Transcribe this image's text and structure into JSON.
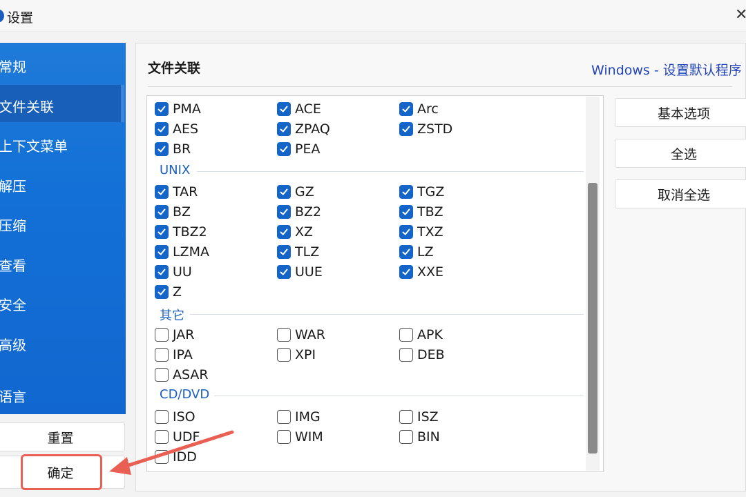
{
  "window": {
    "title": "设置"
  },
  "sidebar": {
    "items": [
      {
        "label": "常规",
        "active": false
      },
      {
        "label": "文件关联",
        "active": true
      },
      {
        "label": "上下文菜单",
        "active": false
      },
      {
        "label": "解压",
        "active": false
      },
      {
        "label": "压缩",
        "active": false
      },
      {
        "label": "查看",
        "active": false
      },
      {
        "label": "安全",
        "active": false
      },
      {
        "label": "高级",
        "active": false
      },
      {
        "label": "语言",
        "active": false
      }
    ],
    "reset_label": "重置",
    "ok_label": "确定"
  },
  "panel": {
    "title": "文件关联",
    "windows_link": "Windows - 设置默认程序"
  },
  "groups": {
    "unix": "UNIX",
    "other": "其它",
    "cd": "CD/DVD"
  },
  "formats": [
    {
      "label": "PMA",
      "checked": true
    },
    {
      "label": "ACE",
      "checked": true
    },
    {
      "label": "Arc",
      "checked": true
    },
    {
      "label": "AES",
      "checked": true
    },
    {
      "label": "ZPAQ",
      "checked": true
    },
    {
      "label": "ZSTD",
      "checked": true
    },
    {
      "label": "BR",
      "checked": true
    },
    {
      "label": "PEA",
      "checked": true
    },
    {
      "label": "TAR",
      "checked": true
    },
    {
      "label": "GZ",
      "checked": true
    },
    {
      "label": "TGZ",
      "checked": true
    },
    {
      "label": "BZ",
      "checked": true
    },
    {
      "label": "BZ2",
      "checked": true
    },
    {
      "label": "TBZ",
      "checked": true
    },
    {
      "label": "TBZ2",
      "checked": true
    },
    {
      "label": "XZ",
      "checked": true
    },
    {
      "label": "TXZ",
      "checked": true
    },
    {
      "label": "LZMA",
      "checked": true
    },
    {
      "label": "TLZ",
      "checked": true
    },
    {
      "label": "LZ",
      "checked": true
    },
    {
      "label": "UU",
      "checked": true
    },
    {
      "label": "UUE",
      "checked": true
    },
    {
      "label": "XXE",
      "checked": true
    },
    {
      "label": "Z",
      "checked": true
    },
    {
      "label": "JAR",
      "checked": false
    },
    {
      "label": "WAR",
      "checked": false
    },
    {
      "label": "APK",
      "checked": false
    },
    {
      "label": "IPA",
      "checked": false
    },
    {
      "label": "XPI",
      "checked": false
    },
    {
      "label": "DEB",
      "checked": false
    },
    {
      "label": "ASAR",
      "checked": false
    },
    {
      "label": "ISO",
      "checked": false
    },
    {
      "label": "IMG",
      "checked": false
    },
    {
      "label": "ISZ",
      "checked": false
    },
    {
      "label": "UDF",
      "checked": false
    },
    {
      "label": "WIM",
      "checked": false
    },
    {
      "label": "BIN",
      "checked": false
    },
    {
      "label": "IDD",
      "checked": false
    }
  ],
  "actions": {
    "basic_label": "基本选项",
    "select_all_label": "全选",
    "deselect_all_label": "取消全选"
  },
  "colors": {
    "sidebar_blue": "#1370d6",
    "checkbox_blue": "#1565c8",
    "group_text": "#1a5fc0",
    "annotation_red": "#ea5f53"
  },
  "icons": {
    "app": "app-logo-icon",
    "close": "close-icon",
    "check": "checkmark-icon",
    "annotation": "red-arrow"
  }
}
